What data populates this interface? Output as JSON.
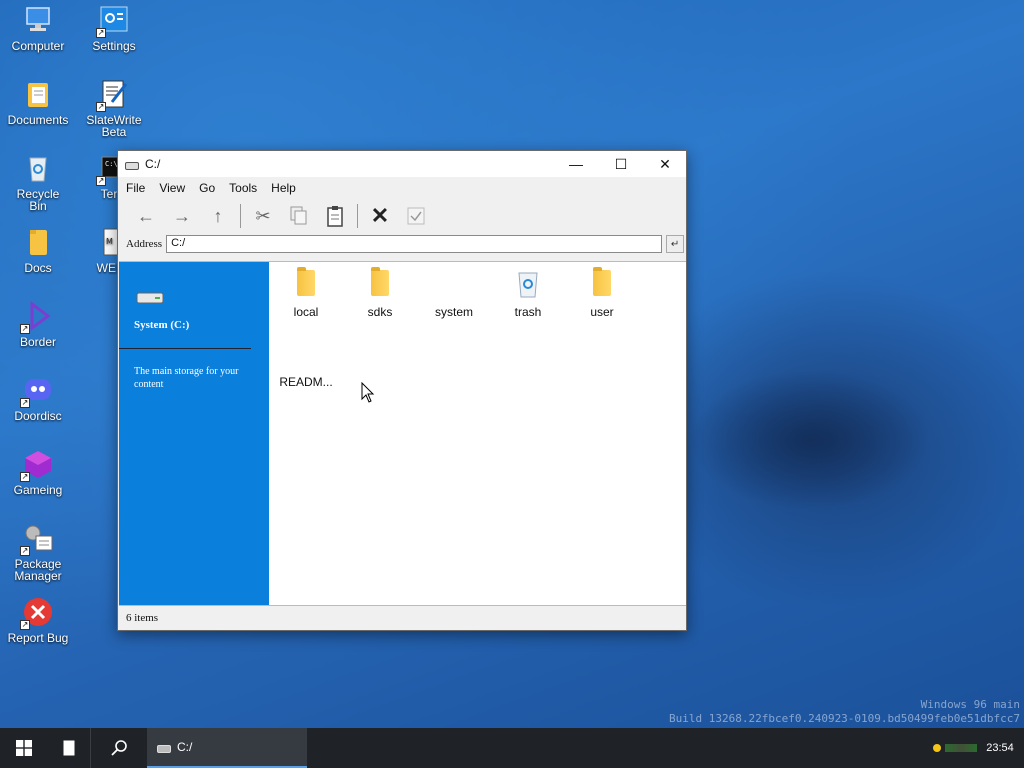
{
  "desktop": {
    "icons": [
      {
        "label": "Computer"
      },
      {
        "label": "Settings"
      },
      {
        "label": "Documents"
      },
      {
        "label": "SlateWrite Beta"
      },
      {
        "label": "Recycle Bin"
      },
      {
        "label": "Term"
      },
      {
        "label": "Docs"
      },
      {
        "label": "WELC"
      },
      {
        "label": "Border"
      },
      {
        "label": "Doordisc"
      },
      {
        "label": "Gameing"
      },
      {
        "label": "Package Manager"
      },
      {
        "label": "Report Bug"
      }
    ]
  },
  "window": {
    "title": "C:/",
    "controls": {
      "minimize": "—",
      "maximize": "☐",
      "close": "✕"
    },
    "menu": [
      "File",
      "View",
      "Go",
      "Tools",
      "Help"
    ],
    "address_label": "Address",
    "address_value": "C:/",
    "sidebar": {
      "drive_name": "System (C:)",
      "description": "The main storage for your content"
    },
    "files": [
      {
        "name": "local",
        "icon": "folder-icon"
      },
      {
        "name": "sdks",
        "icon": "folder-icon"
      },
      {
        "name": "system",
        "icon": "none"
      },
      {
        "name": "trash",
        "icon": "recycle-bin-icon"
      },
      {
        "name": "user",
        "icon": "folder-icon"
      },
      {
        "name": "READM...",
        "icon": "none"
      }
    ],
    "status": "6 items"
  },
  "taskbar": {
    "task_label": "C:/",
    "clock": "23:54"
  },
  "watermark": {
    "line1": "Windows 96 main",
    "line2": "Build 13268.22fbcef0.240923-0109.bd50499feb0e51dbfcc7"
  }
}
